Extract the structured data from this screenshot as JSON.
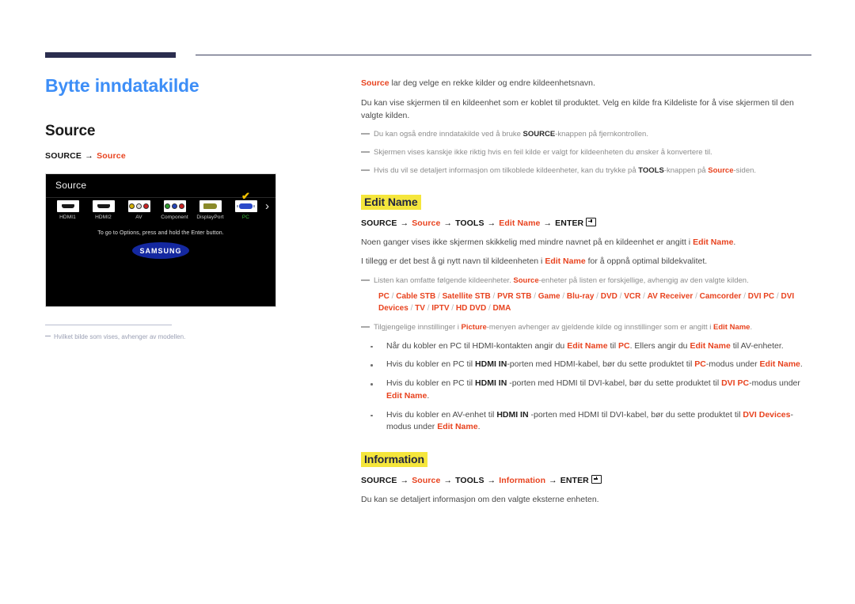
{
  "header": {
    "rule": "decorative-top-rule"
  },
  "left": {
    "doc_title": "Bytte inndatakilde",
    "section_title": "Source",
    "breadcrumb": {
      "root": "SOURCE",
      "arrow": "→",
      "leaf": "Source"
    },
    "tv_panel": {
      "title": "Source",
      "hint": "To go to Options, press and hold the Enter button.",
      "logo": "SAMSUNG",
      "next_arrow": "›",
      "check": "✔",
      "sources": [
        {
          "label": "HDMI1",
          "icon": "hdmi-port-icon",
          "selected": false
        },
        {
          "label": "HDMI2",
          "icon": "hdmi-port-icon",
          "selected": false
        },
        {
          "label": "AV",
          "icon": "av-rca-icon",
          "selected": false
        },
        {
          "label": "Component",
          "icon": "component-rca-icon",
          "selected": false
        },
        {
          "label": "DisplayPort",
          "icon": "displayport-icon",
          "selected": false
        },
        {
          "label": "PC",
          "icon": "vga-port-icon",
          "selected": true
        }
      ]
    },
    "footnote": "Hvilket bilde som vises, avhenger av modellen."
  },
  "right": {
    "intro": {
      "lead_term": "Source",
      "lead_rest": " lar deg velge en rekke kilder og endre kildeenhetsnavn.",
      "para2": "Du kan vise skjermen til en kildeenhet som er koblet til produktet. Velg en kilde fra Kildeliste for å vise skjermen til den valgte kilden."
    },
    "notes": [
      {
        "pre": "Du kan også endre inndatakilde ved å bruke ",
        "bold": "SOURCE",
        "post": "-knappen på fjernkontrollen."
      },
      {
        "pre": "Skjermen vises kanskje ikke riktig hvis en feil kilde er valgt for kildeenheten du ønsker å konvertere til.",
        "bold": "",
        "post": ""
      }
    ],
    "note3": {
      "pre": "Hvis du vil se detaljert informasjon om tilkoblede kildeenheter, kan du trykke på ",
      "bold1": "TOOLS",
      "mid": "-knappen på ",
      "red1": "Source",
      "post": "-siden."
    },
    "edit_name": {
      "heading": "Edit Name",
      "path": {
        "p1": "SOURCE",
        "p2": "Source",
        "p3": "TOOLS",
        "p4": "Edit Name",
        "p5": "ENTER",
        "arrow": "→"
      },
      "para1_pre": "Noen ganger vises ikke skjermen skikkelig med mindre navnet på en kildeenhet er angitt i ",
      "para1_term": "Edit Name",
      "para1_post": ".",
      "para2_pre": "I tillegg er det best å gi nytt navn til kildeenheten i ",
      "para2_term": "Edit Name",
      "para2_post": " for å oppnå optimal bildekvalitet.",
      "note_pre": "Listen kan omfatte følgende kildeenheter. ",
      "note_term": "Source",
      "note_post": "-enheter på listen er forskjellige, avhengig av den valgte kilden.",
      "device_list": [
        "PC",
        "Cable STB",
        "Satellite STB",
        "PVR STB",
        "Game",
        "Blu-ray",
        "DVD",
        "VCR",
        "AV Receiver",
        "Camcorder",
        "DVI PC",
        "DVI Devices",
        "TV",
        "IPTV",
        "HD DVD",
        "DMA"
      ],
      "picture_note": {
        "pre": "Tilgjengelige innstillinger i ",
        "term": "Picture",
        "mid": "-menyen avhenger av gjeldende kilde og innstillinger som er angitt i ",
        "term2": "Edit Name",
        "post": "."
      },
      "bullets": [
        {
          "seg": [
            {
              "t": "Når du kobler en PC til HDMI-kontakten angir du ",
              "s": "n"
            },
            {
              "t": "Edit Name",
              "s": "r"
            },
            {
              "t": " til ",
              "s": "n"
            },
            {
              "t": "PC",
              "s": "r"
            },
            {
              "t": ". Ellers angir du ",
              "s": "n"
            },
            {
              "t": "Edit Name",
              "s": "r"
            },
            {
              "t": " til AV-enheter.",
              "s": "n"
            }
          ]
        },
        {
          "seg": [
            {
              "t": "Hvis du kobler en PC til ",
              "s": "n"
            },
            {
              "t": "HDMI IN",
              "s": "b"
            },
            {
              "t": "-porten med HDMI-kabel, bør du sette produktet til ",
              "s": "n"
            },
            {
              "t": "PC",
              "s": "r"
            },
            {
              "t": "-modus under ",
              "s": "n"
            },
            {
              "t": "Edit Name",
              "s": "r"
            },
            {
              "t": ".",
              "s": "n"
            }
          ]
        },
        {
          "seg": [
            {
              "t": "Hvis du kobler en PC til ",
              "s": "n"
            },
            {
              "t": "HDMI IN",
              "s": "b"
            },
            {
              "t": " -porten med HDMI til DVI-kabel, bør du sette produktet til ",
              "s": "n"
            },
            {
              "t": "DVI PC",
              "s": "r"
            },
            {
              "t": "-modus under ",
              "s": "n"
            },
            {
              "t": "Edit Name",
              "s": "r"
            },
            {
              "t": ".",
              "s": "n"
            }
          ]
        },
        {
          "seg": [
            {
              "t": "Hvis du kobler en AV-enhet til ",
              "s": "n"
            },
            {
              "t": "HDMI IN",
              "s": "b"
            },
            {
              "t": " -porten med HDMI til DVI-kabel, bør du sette produktet til ",
              "s": "n"
            },
            {
              "t": "DVI Devices",
              "s": "r"
            },
            {
              "t": "-modus under ",
              "s": "n"
            },
            {
              "t": "Edit Name",
              "s": "r"
            },
            {
              "t": ".",
              "s": "n"
            }
          ]
        }
      ]
    },
    "information": {
      "heading": "Information",
      "path": {
        "p1": "SOURCE",
        "p2": "Source",
        "p3": "TOOLS",
        "p4": "Information",
        "p5": "ENTER",
        "arrow": "→"
      },
      "para": "Du kan se detaljert informasjon om den valgte eksterne enheten."
    }
  },
  "colors": {
    "accent_blue": "#3d8ef7",
    "accent_red": "#e8431f",
    "highlight_yellow": "#f5e63c",
    "rule_navy": "#2b2e4f",
    "panel_black": "#000000",
    "samsung_blue": "#1428a0",
    "selected_green": "#3dbb3d",
    "check_yellow": "#f2c200"
  }
}
